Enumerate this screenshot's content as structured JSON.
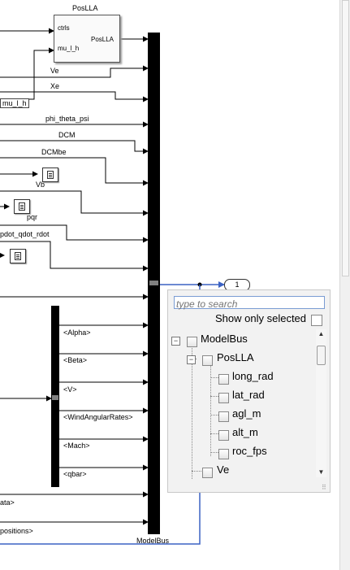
{
  "diagram": {
    "posllablock": {
      "title": "PosLLA",
      "inputs": [
        "ctrls",
        "mu_l_h"
      ],
      "output": "PosLLA"
    },
    "signals": {
      "ve": "Ve",
      "xe": "Xe",
      "mu_l_h": "mu_l_h",
      "phi_theta_psi": "phi_theta_psi",
      "dcm": "DCM",
      "dcmbe": "DCMbe",
      "vb": "Vb",
      "pqr": "pqr",
      "pdot_qdot_rdot": "pdot_qdot_rdot",
      "alpha": "<Alpha>",
      "beta": "<Beta>",
      "v": "<V>",
      "windangularrates": "<WindAngularRates>",
      "mach": "<Mach>",
      "qbar": "<qbar>",
      "ata": "ata>",
      "positions": "positions>"
    },
    "bus_label": "ModelBus",
    "outport_number": "1"
  },
  "popup": {
    "search_placeholder": "type to search",
    "show_only_selected": "Show only selected",
    "tree": [
      {
        "label": "ModelBus",
        "level": 0,
        "expander": "−"
      },
      {
        "label": "PosLLA",
        "level": 1,
        "expander": "−"
      },
      {
        "label": "long_rad",
        "level": 2
      },
      {
        "label": "lat_rad",
        "level": 2
      },
      {
        "label": "agl_m",
        "level": 2
      },
      {
        "label": "alt_m",
        "level": 2
      },
      {
        "label": "roc_fps",
        "level": 2
      },
      {
        "label": "Ve",
        "level": 1
      }
    ],
    "scroll_up": "▲",
    "scroll_down": "▼",
    "grip": "⠿"
  },
  "colors": {
    "bus_line": "#3b62c4",
    "signal_line": "#000000",
    "popup_bg": "#f2f2f2"
  }
}
